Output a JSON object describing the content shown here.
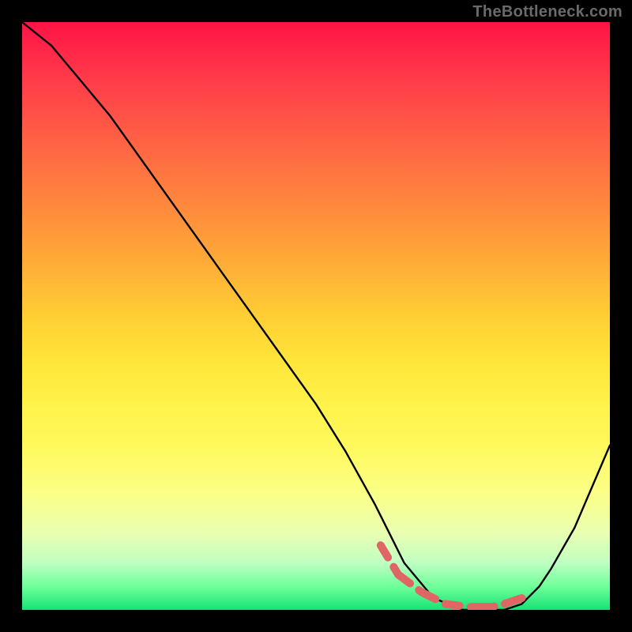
{
  "watermark": "TheBottleneck.com",
  "colors": {
    "background": "#000000",
    "curve": "#000000",
    "dash": "#e06666",
    "watermark": "#6a6a6a"
  },
  "chart_data": {
    "type": "line",
    "title": "",
    "xlabel": "",
    "ylabel": "",
    "xlim": [
      0,
      100
    ],
    "ylim": [
      0,
      100
    ],
    "grid": false,
    "legend": false,
    "series": [
      {
        "name": "bottleneck-curve",
        "x": [
          0,
          5,
          10,
          15,
          20,
          25,
          30,
          35,
          40,
          45,
          50,
          55,
          60,
          62,
          65,
          70,
          75,
          78,
          80,
          82,
          85,
          88,
          90,
          94,
          100
        ],
        "y": [
          100,
          96,
          90,
          84,
          77,
          70,
          63,
          56,
          49,
          42,
          35,
          27,
          18,
          14,
          8,
          2,
          0,
          0,
          0,
          0,
          1,
          4,
          7,
          14,
          28
        ]
      }
    ],
    "highlight_segment": {
      "name": "valley-highlight",
      "x": [
        61,
        64,
        68,
        72,
        76,
        80,
        82,
        85
      ],
      "y": [
        11,
        6,
        3,
        1,
        0.5,
        0.5,
        1,
        2
      ]
    }
  }
}
